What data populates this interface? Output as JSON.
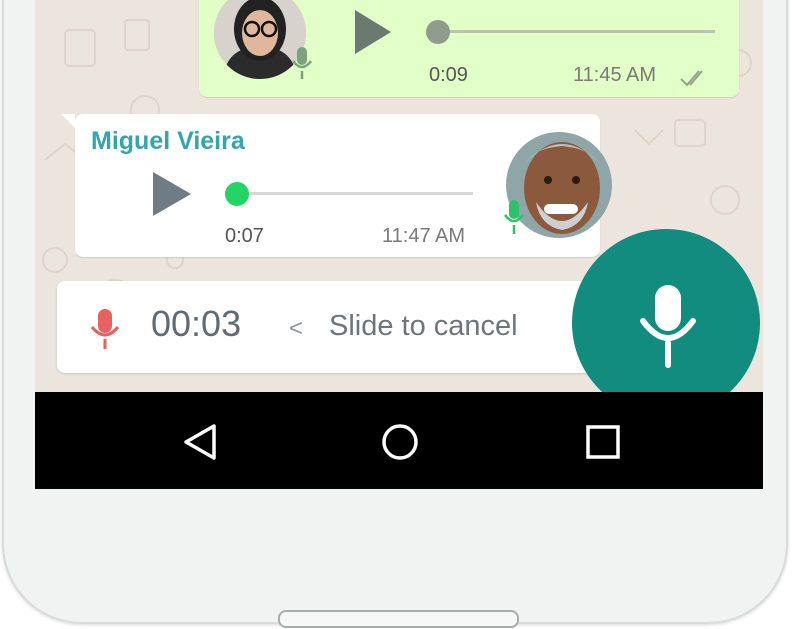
{
  "outgoing_voice_note": {
    "duration": "0:09",
    "time": "11:45 AM",
    "status_icon": "double-check-icon",
    "avatar": "woman-avatar",
    "mic_icon": "mic-icon",
    "progress": 0.0
  },
  "incoming_voice_note": {
    "sender": "Miguel Vieira",
    "duration": "0:07",
    "time": "11:47 AM",
    "avatar": "man-avatar",
    "mic_icon": "mic-icon",
    "progress": 0.0
  },
  "recording_bar": {
    "mic_icon": "mic-icon",
    "timer": "00:03",
    "chevron": "<",
    "slide_label": "Slide to cancel"
  },
  "record_button": {
    "icon": "mic-icon",
    "color": "#128c7e"
  },
  "nav_bar": {
    "buttons": [
      "back-icon",
      "home-icon",
      "recents-icon"
    ]
  },
  "colors": {
    "outgoing_bubble": "#e2ffc7",
    "sender_name": "#35a5ac",
    "played_knob": "#25d366",
    "record_mic": "#e5625e"
  }
}
